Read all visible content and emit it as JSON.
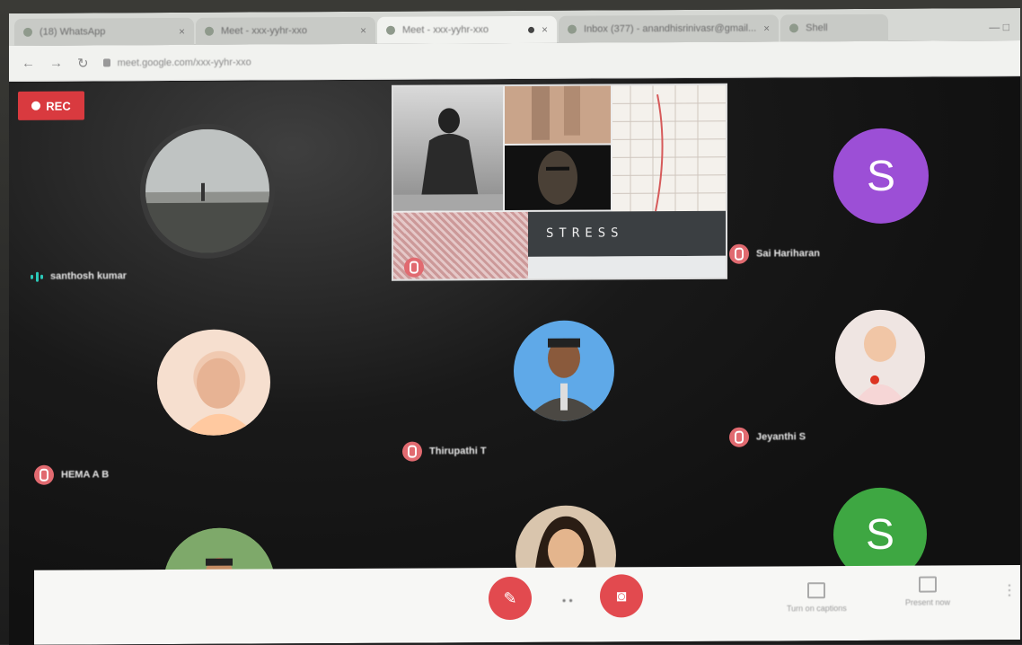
{
  "browser": {
    "tabs": [
      {
        "title": "(18) WhatsApp",
        "active": false
      },
      {
        "title": "Meet - xxx-yyhr-xxo",
        "active": false
      },
      {
        "title": "Meet - xxx-yyhr-xxo",
        "active": true
      },
      {
        "title": "Inbox (377) - anandhisrinivasr@gmail...",
        "active": false
      },
      {
        "title": "Shell",
        "active": false
      }
    ],
    "url": "meet.google.com/xxx-yyhr-xxo",
    "window_controls": "—  □"
  },
  "meeting": {
    "rec_label": "REC",
    "participants": [
      {
        "name": "santhosh kumar",
        "avatar": "landscape-photo",
        "muted": false
      },
      {
        "name": "Sai Hariharan",
        "avatar": "letter",
        "letter": "S",
        "color": "#9c4fd6",
        "muted": true
      },
      {
        "name": "HEMA A B",
        "avatar": "person-photo",
        "muted": true
      },
      {
        "name": "Thirupathi T",
        "avatar": "person-photo",
        "muted": true
      },
      {
        "name": "Jeyanthi S",
        "avatar": "child-photo",
        "muted": true
      },
      {
        "name": "",
        "avatar": "child-photo",
        "muted": false
      },
      {
        "name": "",
        "avatar": "person-photo",
        "muted": false
      },
      {
        "name": "",
        "avatar": "letter",
        "letter": "S",
        "color": "#3ea742",
        "muted": false
      }
    ],
    "presentation": {
      "slide_word": "STRESS"
    }
  },
  "controls": {
    "more_label": "•  •",
    "captions_label": "Turn on captions",
    "present_label": "Present now",
    "more_options": "⋮"
  }
}
